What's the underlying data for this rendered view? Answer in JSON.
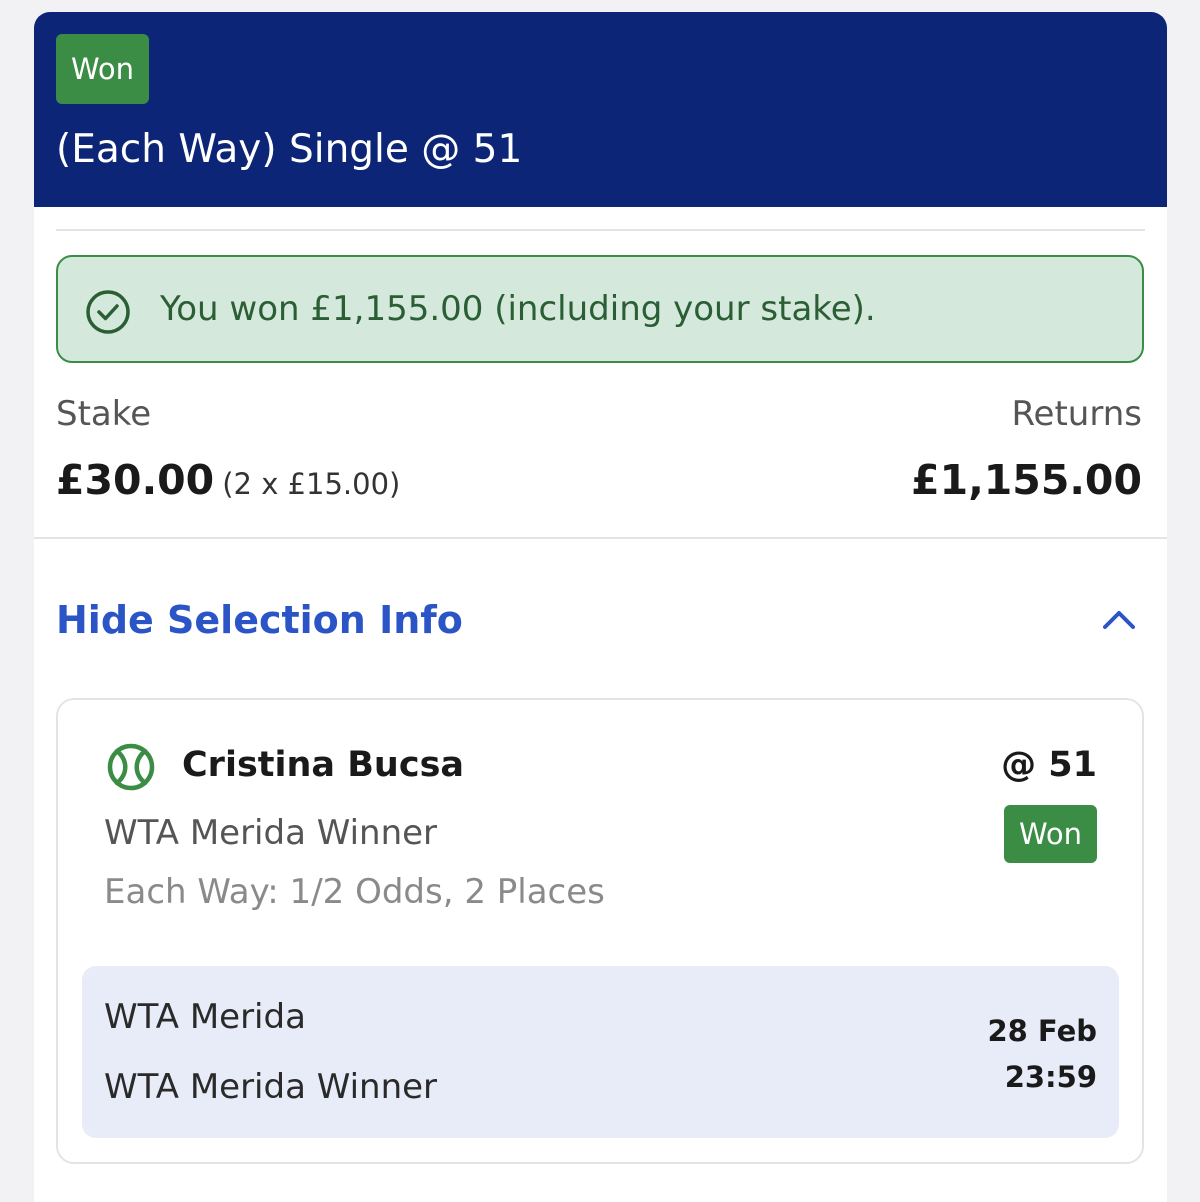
{
  "bet": {
    "status_badge": "Won",
    "title": "(Each Way) Single @ 51"
  },
  "result_banner": {
    "icon": "check-circle-icon",
    "text": "You won £1,155.00 (including your stake).",
    "colors": {
      "background": "#d5e8dc",
      "border": "#3b8c45",
      "text": "#2a5e35"
    }
  },
  "summary": {
    "stake_label": "Stake",
    "stake_value": "£30.00",
    "stake_breakdown": "(2 x £15.00)",
    "returns_label": "Returns",
    "returns_value": "£1,155.00"
  },
  "selection_toggle": {
    "label": "Hide Selection Info",
    "icon": "chevron-up-icon"
  },
  "selection": {
    "sport_icon": "tennis-ball-icon",
    "name": "Cristina Bucsa",
    "odds": "@ 51",
    "market": "WTA Merida Winner",
    "status_badge": "Won",
    "each_way_terms": "Each Way: 1/2 Odds, 2 Places",
    "event": {
      "name": "WTA Merida",
      "market": "WTA Merida Winner",
      "date": "28 Feb",
      "time": "23:59"
    }
  },
  "colors": {
    "header_bg": "#0c2577",
    "won_badge": "#3b8c45",
    "link": "#2b55c6",
    "event_panel_bg": "#e8ecf8"
  }
}
